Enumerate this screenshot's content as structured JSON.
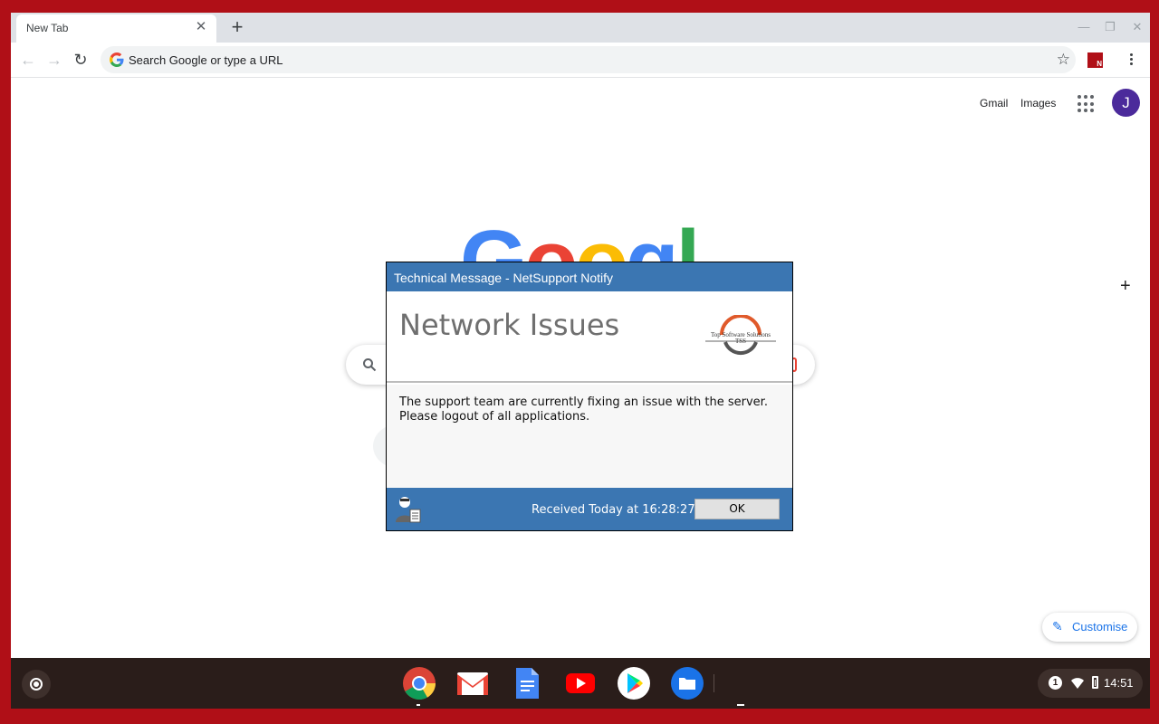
{
  "browser": {
    "tab_title": "New Tab",
    "omnibox_placeholder": "Search Google or type a URL"
  },
  "ntp": {
    "links": [
      "Gmail",
      "Images"
    ],
    "avatar_letter": "J",
    "logo_text": "Google",
    "customise_label": "Customise"
  },
  "dialog": {
    "title": "Technical Message - NetSupport Notify",
    "heading": "Network Issues",
    "logo_line1": "Top Software Solutions",
    "logo_line2": "TSS",
    "body_line1": "The support team are currently fixing an issue with the server.",
    "body_line2": "Please logout of all applications.",
    "received": "Received Today at 16:28:27",
    "ok_label": "OK"
  },
  "shelf": {
    "apps": [
      "chrome-icon",
      "gmail-icon",
      "docs-icon",
      "youtube-icon",
      "play-store-icon",
      "files-icon"
    ],
    "notification_count": "1",
    "time": "14:51"
  },
  "colors": {
    "desktop": "#b00f17",
    "dialog_accent": "#3b76b2",
    "avatar": "#4b2a9b"
  }
}
